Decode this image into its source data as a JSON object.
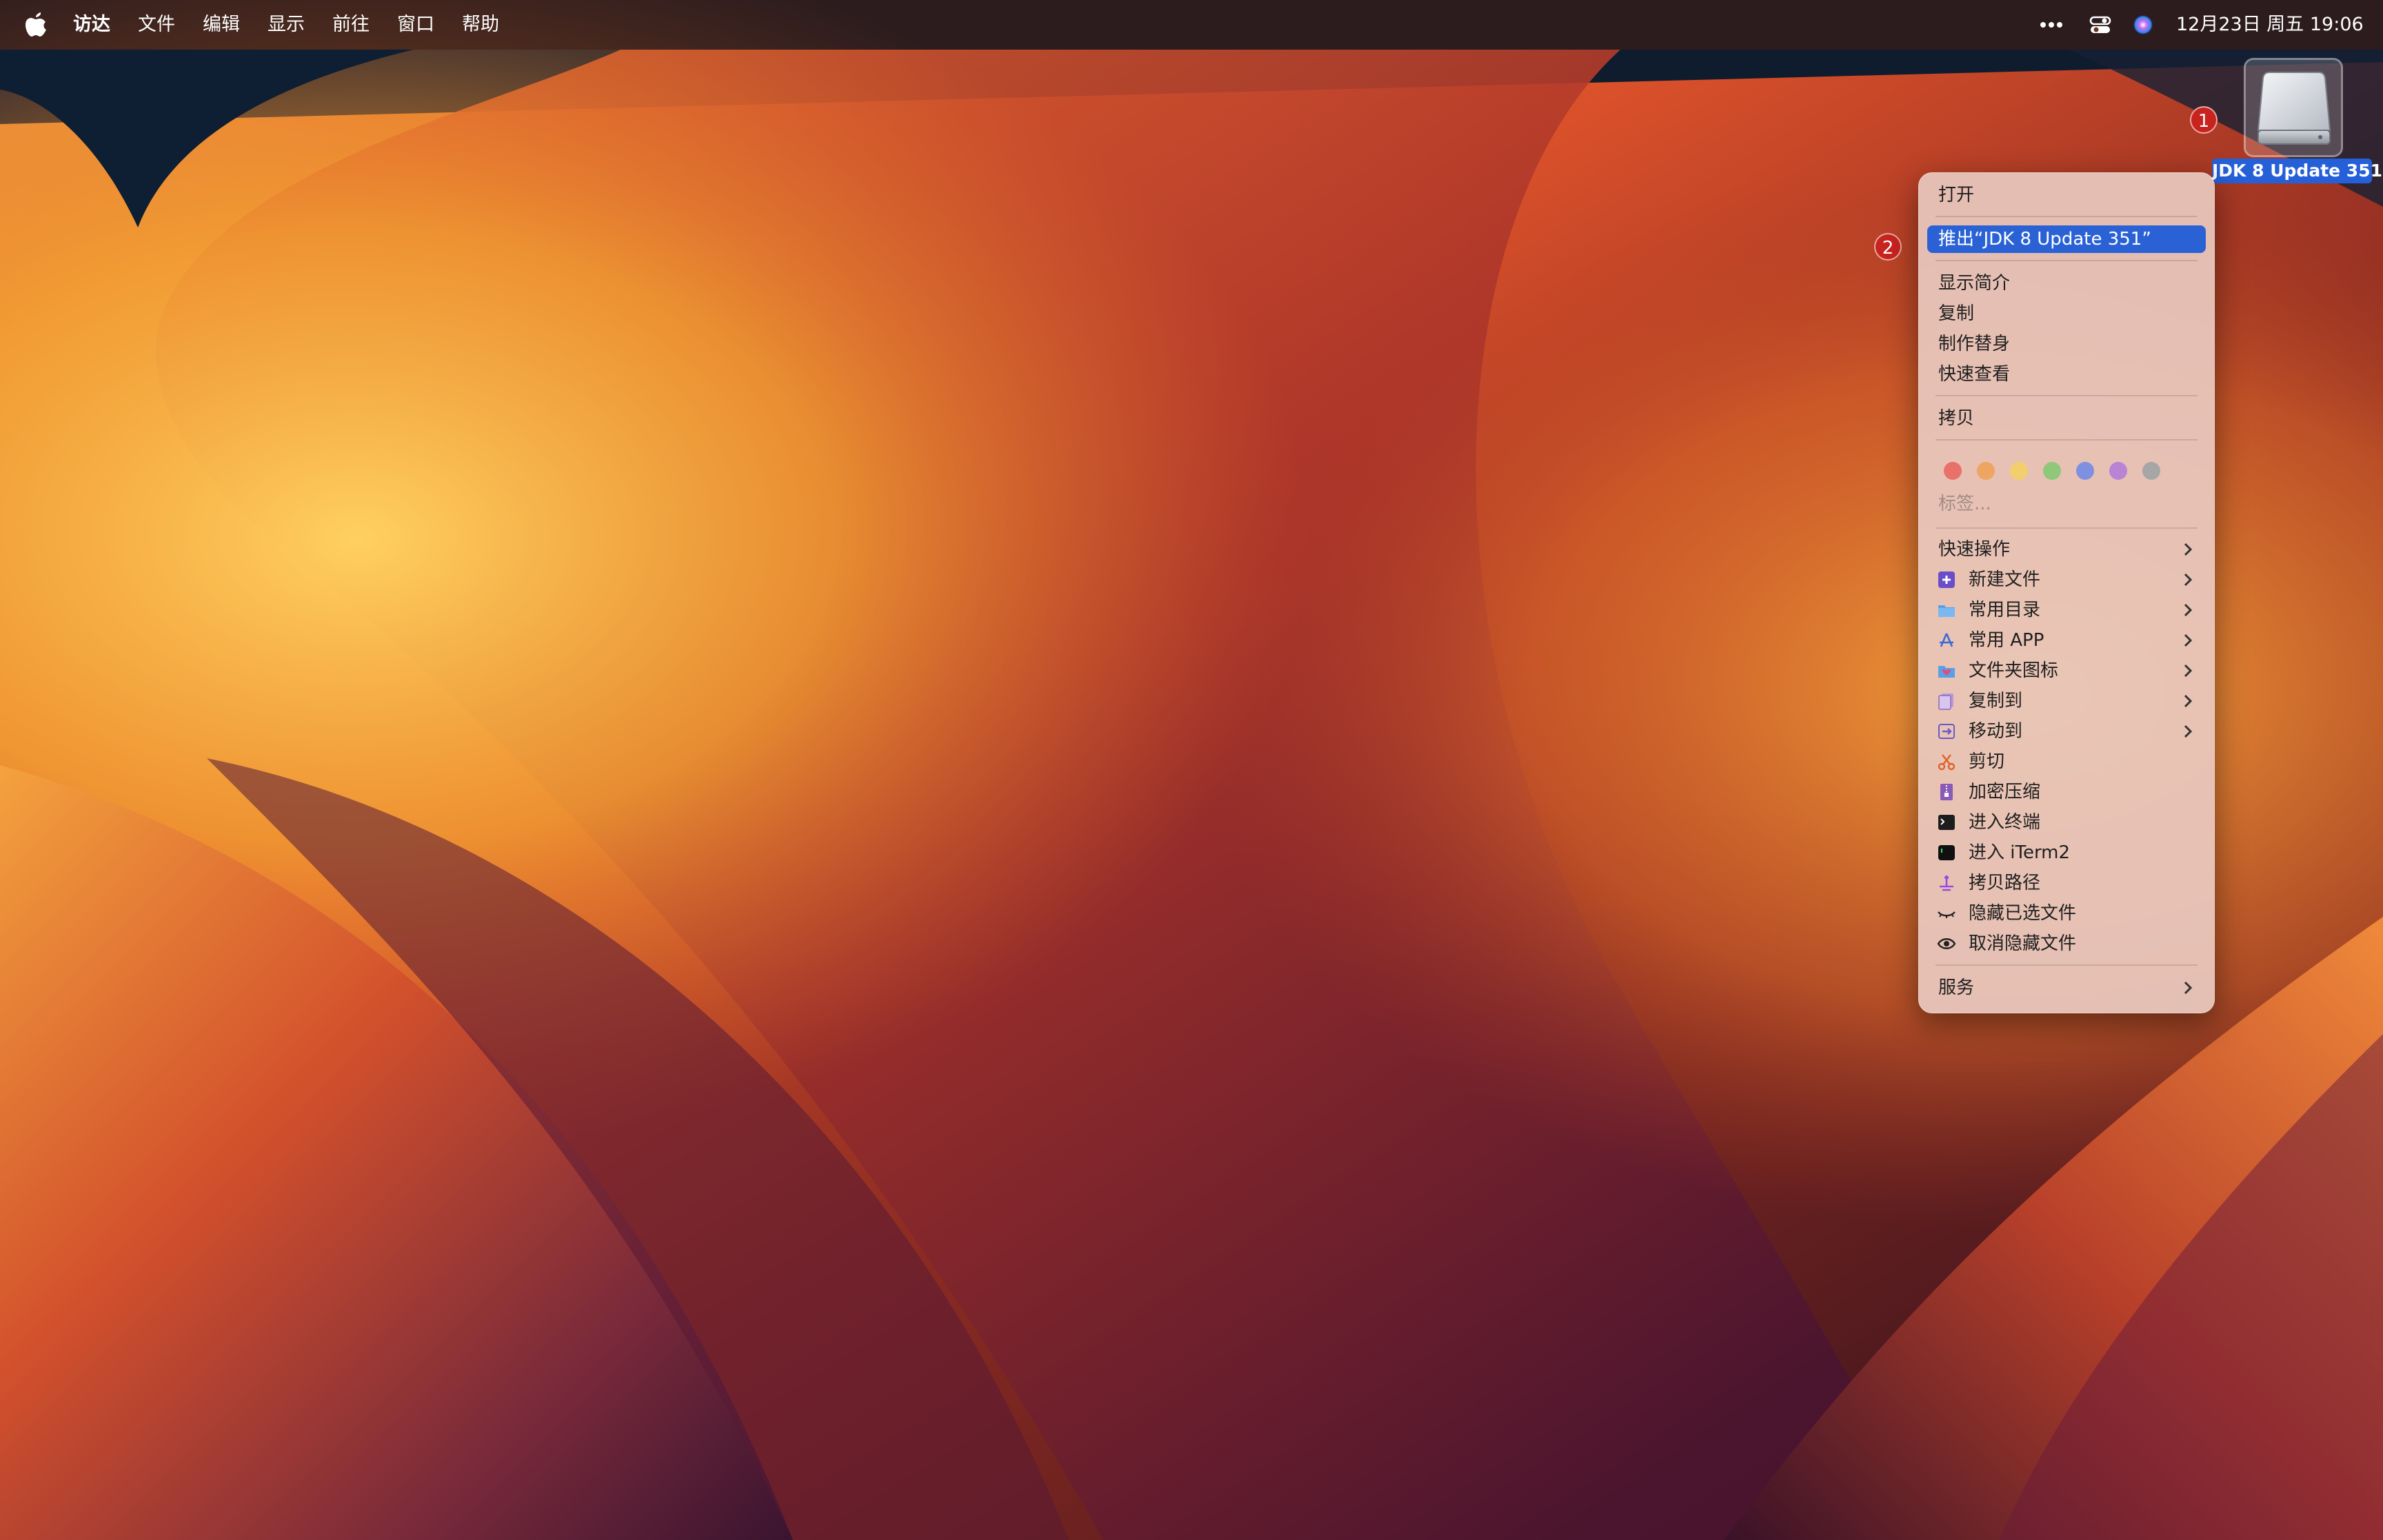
{
  "menubar": {
    "app_name": "访达",
    "items": [
      "文件",
      "编辑",
      "显示",
      "前往",
      "窗口",
      "帮助"
    ],
    "datetime": "12月23日 周五  19:06"
  },
  "desktop": {
    "drive_label": "JDK 8 Update 351",
    "badge_1": "1",
    "badge_2": "2"
  },
  "context_menu": {
    "open": "打开",
    "eject": "推出“JDK 8 Update 351”",
    "get_info": "显示简介",
    "duplicate": "复制",
    "make_alias": "制作替身",
    "quick_look": "快速查看",
    "copy": "拷贝",
    "tags": "标签...",
    "tag_colors": [
      "#e8726a",
      "#efa562",
      "#f2cf6c",
      "#8fc77b",
      "#7f90e0",
      "#b983d6",
      "#a6a6a6"
    ],
    "quick_actions": "快速操作",
    "new_file": "新建文件",
    "common_dirs": "常用目录",
    "common_apps": "常用 APP",
    "folder_icon": "文件夹图标",
    "copy_to": "复制到",
    "move_to": "移动到",
    "cut": "剪切",
    "encrypt_zip": "加密压缩",
    "open_terminal": "进入终端",
    "open_iterm2": "进入 iTerm2",
    "copy_path": "拷贝路径",
    "hide_selected": "隐藏已选文件",
    "unhide_files": "取消隐藏文件",
    "services": "服务"
  },
  "colors": {
    "menu_highlight": "#2a62d6",
    "badge": "#c8231e",
    "drive_label_bg": "#2560d8"
  }
}
